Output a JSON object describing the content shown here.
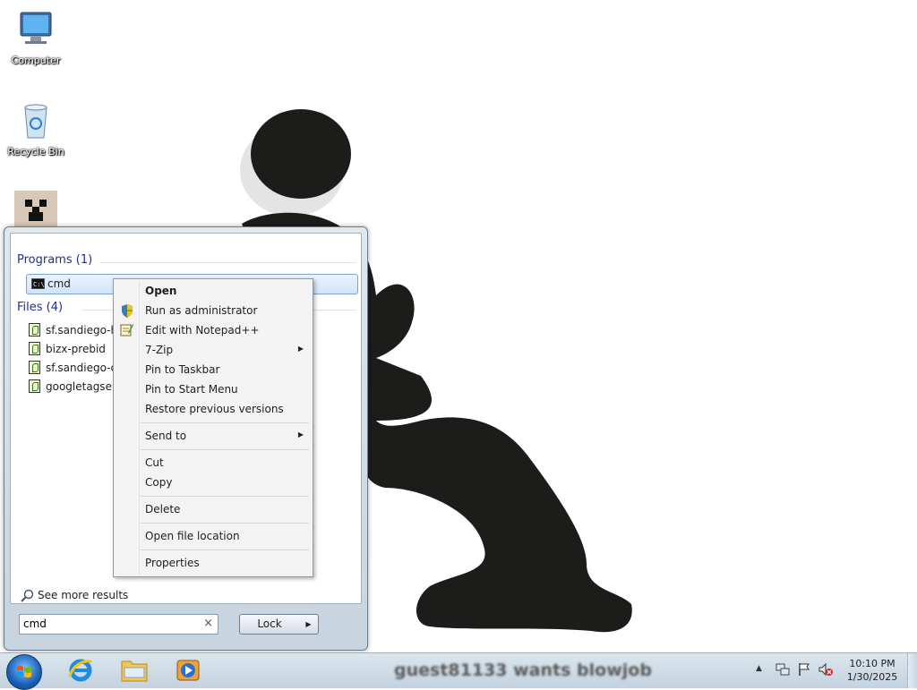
{
  "desktop": {
    "icons": [
      {
        "label": "Computer",
        "icon": "computer-icon"
      },
      {
        "label": "Recycle Bin",
        "icon": "recycle-bin-icon"
      },
      {
        "label": "",
        "icon": "creeper-icon"
      }
    ]
  },
  "start_menu": {
    "programs_header": "Programs (1)",
    "programs": [
      {
        "label": "cmd",
        "icon": "cmd-icon"
      }
    ],
    "files_header": "Files (4)",
    "files": [
      {
        "label": "sf.sandiego-he"
      },
      {
        "label": "bizx-prebid"
      },
      {
        "label": "sf.sandiego-cm"
      },
      {
        "label": "googletagservi"
      }
    ],
    "see_more": "See more results",
    "search": {
      "value": "cmd",
      "clear": "×"
    },
    "lock_button": "Lock",
    "lock_arrow": "▶"
  },
  "context_menu": {
    "items": [
      {
        "label": "Open",
        "bold": true
      },
      {
        "label": "Run as administrator",
        "icon": "uac-shield-icon"
      },
      {
        "label": "Edit with Notepad++",
        "icon": "notepad-plus-plus-icon"
      },
      {
        "label": "7-Zip",
        "submenu": true
      },
      {
        "label": "Pin to Taskbar"
      },
      {
        "label": "Pin to Start Menu"
      },
      {
        "label": "Restore previous versions"
      },
      {
        "label": "Send to",
        "submenu": true
      },
      {
        "label": "Cut"
      },
      {
        "label": "Copy"
      },
      {
        "label": "Delete"
      },
      {
        "label": "Open file location"
      },
      {
        "label": "Properties"
      }
    ],
    "submenu_arrow": "▶"
  },
  "taskbar": {
    "pinned": [
      "internet-explorer-icon",
      "windows-explorer-icon",
      "media-player-icon"
    ],
    "notification": "guest81133 wants blowjob",
    "tray": [
      "show-hidden-icons",
      "network-icon",
      "action-center-flag-icon",
      "volume-muted-icon"
    ],
    "tray_arrow": "▲",
    "clock": {
      "time": "10:10 PM",
      "date": "1/30/2025"
    }
  },
  "colors": {
    "group_header": "#1e3287",
    "selection_border": "#7da2ce",
    "taskbar": "#c3d2de"
  }
}
